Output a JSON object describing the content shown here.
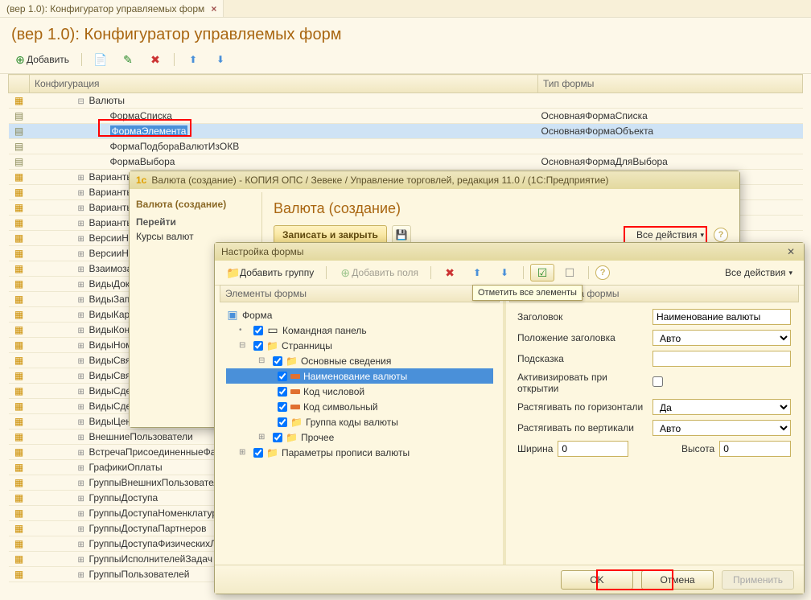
{
  "tab": {
    "title": "(вер 1.0): Конфигуратор управляемых форм"
  },
  "page_title": "(вер 1.0): Конфигуратор управляемых форм",
  "main_toolbar": {
    "add": "Добавить"
  },
  "grid": {
    "col_config": "Конфигурация",
    "col_type": "Тип формы",
    "root": "Валюты",
    "rows": [
      {
        "cfg": "ФормаСписка",
        "type": "ОсновнаяФормаСписка"
      },
      {
        "cfg": "ФормаЭлемента",
        "type": "ОсновнаяФормаОбъекта",
        "sel": true
      },
      {
        "cfg": "ФормаПодбораВалютИзОКВ",
        "type": ""
      },
      {
        "cfg": "ФормаВыбора",
        "type": "ОсновнаяФормаДляВыбора"
      }
    ],
    "others": [
      "Варианты",
      "Варианты",
      "Варианты",
      "Варианты",
      "ВерсииН",
      "ВерсииН",
      "Взаимоза",
      "ВидыДок",
      "ВидыЗап",
      "ВидыКар",
      "ВидыКон",
      "ВидыНом",
      "ВидыСвя",
      "ВидыСвя",
      "ВидыСде",
      "ВидыСде",
      "ВидыЦен",
      "ВнешниеПользователи",
      "ВстречаПрисоединенныеФайл",
      "ГрафикиОплаты",
      "ГруппыВнешнихПользователей",
      "ГруппыДоступа",
      "ГруппыДоступаНоменклатуры",
      "ГруппыДоступаПартнеров",
      "ГруппыДоступаФизическихЛиц",
      "ГруппыИсполнителейЗадач",
      "ГруппыПользователей"
    ]
  },
  "modal1": {
    "title": "Валюта (создание) - КОПИЯ ОПС / Зевеке / Управление торговлей, редакция 11.0 /  (1С:Предприятие)",
    "nav_header": "Валюта (создание)",
    "nav_go": "Перейти",
    "nav_link": "Курсы валют",
    "content_title": "Валюта (создание)",
    "save_close": "Записать и закрыть",
    "all_actions": "Все действия"
  },
  "modal2": {
    "title": "Настройка формы",
    "add_group": "Добавить группу",
    "add_fields": "Добавить поля",
    "all_actions": "Все действия",
    "tooltip": "Отметить все элементы",
    "tree_header": "Элементы формы",
    "props_header_hidden": "та формы",
    "tree": {
      "root": "Форма",
      "cmd": "Командная панель",
      "pages": "Странницы",
      "main": "Основные сведения",
      "name": "Наименование валюты",
      "code_num": "Код числовой",
      "code_sym": "Код символьный",
      "group_codes": "Группа коды валюты",
      "other": "Прочее",
      "params": "Параметры прописи валюты"
    },
    "props": {
      "title_lbl": "Заголовок",
      "title_val": "Наименование валюты",
      "title_pos_lbl": "Положение заголовка",
      "title_pos_val": "Авто",
      "hint_lbl": "Подсказка",
      "hint_val": "",
      "activate_lbl": "Активизировать при открытии",
      "stretch_h_lbl": "Растягивать по горизонтали",
      "stretch_h_val": "Да",
      "stretch_v_lbl": "Растягивать по вертикали",
      "stretch_v_val": "Авто",
      "width_lbl": "Ширина",
      "width_val": "0",
      "height_lbl": "Высота",
      "height_val": "0"
    },
    "footer": {
      "ok": "OK",
      "cancel": "Отмена",
      "apply": "Применить"
    }
  }
}
